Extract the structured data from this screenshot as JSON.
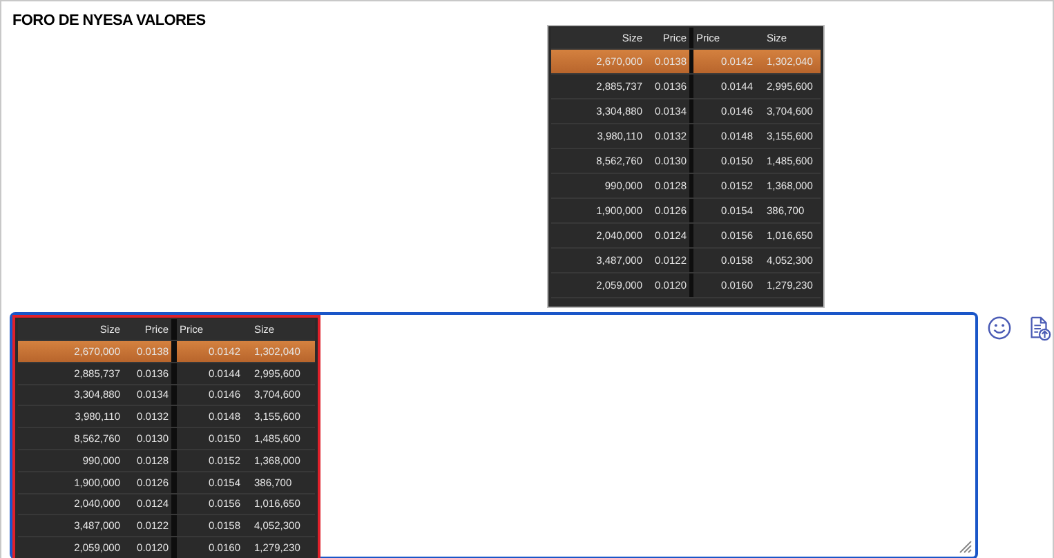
{
  "title": "FORO DE NYESA VALORES",
  "books": [
    {
      "selected": false,
      "columns": [
        "Size",
        "Price",
        "Price",
        "Size"
      ],
      "rows": [
        {
          "bid_size": "2,670,000",
          "bid_price": "0.0138",
          "ask_price": "0.0142",
          "ask_size": "1,302,040",
          "highlighted": true
        },
        {
          "bid_size": "2,885,737",
          "bid_price": "0.0136",
          "ask_price": "0.0144",
          "ask_size": "2,995,600",
          "highlighted": false
        },
        {
          "bid_size": "3,304,880",
          "bid_price": "0.0134",
          "ask_price": "0.0146",
          "ask_size": "3,704,600",
          "highlighted": false
        },
        {
          "bid_size": "3,980,110",
          "bid_price": "0.0132",
          "ask_price": "0.0148",
          "ask_size": "3,155,600",
          "highlighted": false
        },
        {
          "bid_size": "8,562,760",
          "bid_price": "0.0130",
          "ask_price": "0.0150",
          "ask_size": "1,485,600",
          "highlighted": false
        },
        {
          "bid_size": "990,000",
          "bid_price": "0.0128",
          "ask_price": "0.0152",
          "ask_size": "1,368,000",
          "highlighted": false
        },
        {
          "bid_size": "1,900,000",
          "bid_price": "0.0126",
          "ask_price": "0.0154",
          "ask_size": "386,700",
          "highlighted": false
        },
        {
          "bid_size": "2,040,000",
          "bid_price": "0.0124",
          "ask_price": "0.0156",
          "ask_size": "1,016,650",
          "highlighted": false
        },
        {
          "bid_size": "3,487,000",
          "bid_price": "0.0122",
          "ask_price": "0.0158",
          "ask_size": "4,052,300",
          "highlighted": false
        },
        {
          "bid_size": "2,059,000",
          "bid_price": "0.0120",
          "ask_price": "0.0160",
          "ask_size": "1,279,230",
          "highlighted": false
        }
      ]
    },
    {
      "selected": true,
      "columns": [
        "Size",
        "Price",
        "Price",
        "Size"
      ],
      "rows": [
        {
          "bid_size": "2,670,000",
          "bid_price": "0.0138",
          "ask_price": "0.0142",
          "ask_size": "1,302,040",
          "highlighted": true
        },
        {
          "bid_size": "2,885,737",
          "bid_price": "0.0136",
          "ask_price": "0.0144",
          "ask_size": "2,995,600",
          "highlighted": false
        },
        {
          "bid_size": "3,304,880",
          "bid_price": "0.0134",
          "ask_price": "0.0146",
          "ask_size": "3,704,600",
          "highlighted": false
        },
        {
          "bid_size": "3,980,110",
          "bid_price": "0.0132",
          "ask_price": "0.0148",
          "ask_size": "3,155,600",
          "highlighted": false
        },
        {
          "bid_size": "8,562,760",
          "bid_price": "0.0130",
          "ask_price": "0.0150",
          "ask_size": "1,485,600",
          "highlighted": false
        },
        {
          "bid_size": "990,000",
          "bid_price": "0.0128",
          "ask_price": "0.0152",
          "ask_size": "1,368,000",
          "highlighted": false
        },
        {
          "bid_size": "1,900,000",
          "bid_price": "0.0126",
          "ask_price": "0.0154",
          "ask_size": "386,700",
          "highlighted": false
        },
        {
          "bid_size": "2,040,000",
          "bid_price": "0.0124",
          "ask_price": "0.0156",
          "ask_size": "1,016,650",
          "highlighted": false
        },
        {
          "bid_size": "3,487,000",
          "bid_price": "0.0122",
          "ask_price": "0.0158",
          "ask_size": "4,052,300",
          "highlighted": false
        },
        {
          "bid_size": "2,059,000",
          "bid_price": "0.0120",
          "ask_price": "0.0160",
          "ask_size": "1,279,230",
          "highlighted": false
        }
      ]
    }
  ]
}
